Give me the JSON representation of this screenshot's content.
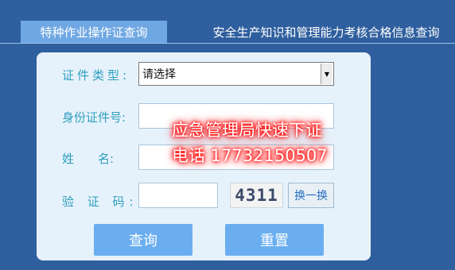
{
  "tabs": {
    "active": "特种作业操作证查询",
    "other": "安全生产知识和管理能力考核合格信息查询"
  },
  "form": {
    "cert_type_label": "证件类型:",
    "cert_type_value": "请选择",
    "id_label": "身份证件号:",
    "name_label": "姓　　名:",
    "captcha_label": "验 证 码:",
    "captcha_text": "4311",
    "swap_label": "换一换",
    "query_label": "查询",
    "reset_label": "重置"
  },
  "overlay": {
    "line1": "应急管理局快速下证",
    "line2": "电话 17732150507"
  },
  "colors": {
    "background": "#2f5f9e",
    "tab_active": "#6fa7e3",
    "panel": "#e6f2fb",
    "label": "#2e9fbf",
    "button": "#6aaef0",
    "overlay_glow": "#ff0000"
  },
  "icons": {
    "select_arrow": "dropdown-arrow-icon"
  }
}
